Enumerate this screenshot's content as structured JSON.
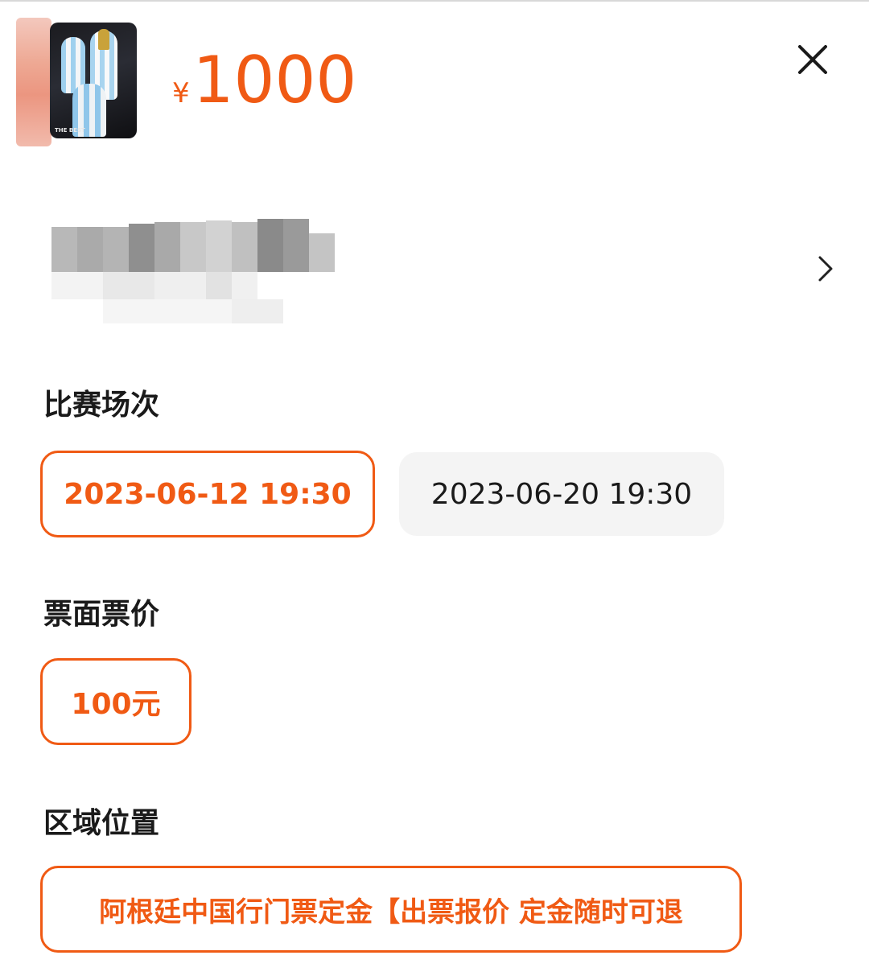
{
  "header": {
    "currency_symbol": "¥",
    "price": "1000",
    "thumbnail_text": "THE BEST"
  },
  "sections": {
    "match": {
      "title": "比赛场次",
      "options": [
        {
          "label": "2023-06-12 19:30",
          "selected": true
        },
        {
          "label": "2023-06-20 19:30",
          "selected": false
        }
      ]
    },
    "face_price": {
      "title": "票面票价",
      "options": [
        {
          "label": "100元",
          "selected": true
        }
      ]
    },
    "area": {
      "title": "区域位置",
      "options": [
        {
          "label": "阿根廷中国行门票定金【出票报价 定金随时可退",
          "selected": true
        }
      ]
    }
  },
  "colors": {
    "accent": "#f05a14",
    "chip_bg": "#f4f4f4",
    "text": "#1a1a1a"
  },
  "icons": {
    "close": "close-icon",
    "chevron": "chevron-right-icon"
  }
}
